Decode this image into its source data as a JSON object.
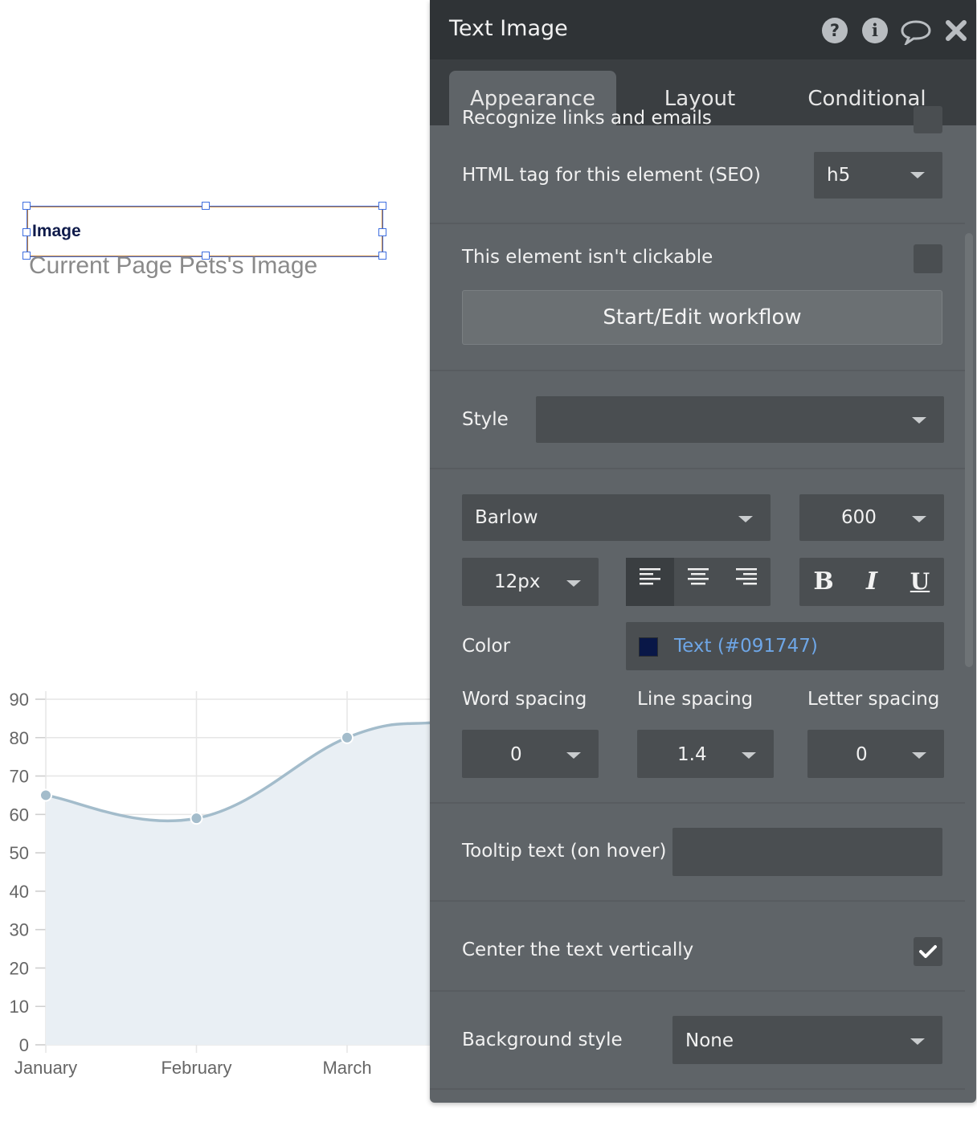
{
  "canvas": {
    "element_text": "Image",
    "element_caption": "Current Page Pets's Image"
  },
  "chart_data": {
    "type": "area",
    "categories": [
      "January",
      "February",
      "March"
    ],
    "values": [
      65,
      59,
      80
    ],
    "continuation_peak_estimate": 84,
    "yticks": [
      "0",
      "10",
      "20",
      "30",
      "40",
      "50",
      "60",
      "70",
      "80",
      "90"
    ],
    "ylim": [
      0,
      90
    ],
    "grid": true,
    "line_color": "#a3bccb",
    "fill_color": "#e9eff4"
  },
  "panel": {
    "title": "Text Image",
    "header_icons": [
      "help-icon",
      "info-icon",
      "comment-icon",
      "close-icon"
    ],
    "tabs": [
      {
        "label": "Appearance",
        "active": true
      },
      {
        "label": "Layout",
        "active": false
      },
      {
        "label": "Conditional",
        "active": false
      }
    ],
    "cutoff_label": "Recognize links and emails",
    "html_tag": {
      "label": "HTML tag for this element (SEO)",
      "value": "h5"
    },
    "not_clickable": {
      "label": "This element isn't clickable",
      "checked": false
    },
    "workflow_button": "Start/Edit workflow",
    "style": {
      "label": "Style",
      "value": ""
    },
    "font": {
      "family": "Barlow",
      "weight": "600",
      "size": "12px"
    },
    "alignment": {
      "selected": "left",
      "options": [
        "left",
        "center",
        "right"
      ]
    },
    "format_buttons": {
      "bold": "B",
      "italic": "I",
      "underline": "U"
    },
    "color": {
      "label": "Color",
      "value": "Text (#091747)",
      "swatch": "#091747"
    },
    "spacing": {
      "word_label": "Word spacing",
      "word_value": "0",
      "line_label": "Line spacing",
      "line_value": "1.4",
      "letter_label": "Letter spacing",
      "letter_value": "0"
    },
    "tooltip": {
      "label": "Tooltip text (on hover)",
      "value": ""
    },
    "center_vertically": {
      "label": "Center the text vertically",
      "checked": true
    },
    "background_style": {
      "label": "Background style",
      "value": "None"
    }
  }
}
